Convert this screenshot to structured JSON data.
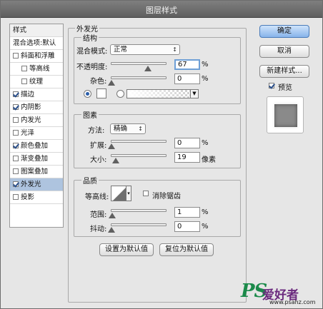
{
  "window": {
    "title": "图层样式"
  },
  "sidebar": {
    "header": "样式",
    "items": [
      {
        "label": "混合选项:默认",
        "checkbox": false,
        "checked": false,
        "indent": false,
        "selected": false
      },
      {
        "label": "斜面和浮雕",
        "checkbox": true,
        "checked": false,
        "indent": false,
        "selected": false
      },
      {
        "label": "等高线",
        "checkbox": true,
        "checked": false,
        "indent": true,
        "selected": false
      },
      {
        "label": "纹理",
        "checkbox": true,
        "checked": false,
        "indent": true,
        "selected": false
      },
      {
        "label": "描边",
        "checkbox": true,
        "checked": true,
        "indent": false,
        "selected": false
      },
      {
        "label": "内阴影",
        "checkbox": true,
        "checked": true,
        "indent": false,
        "selected": false
      },
      {
        "label": "内发光",
        "checkbox": true,
        "checked": false,
        "indent": false,
        "selected": false
      },
      {
        "label": "光泽",
        "checkbox": true,
        "checked": false,
        "indent": false,
        "selected": false
      },
      {
        "label": "颜色叠加",
        "checkbox": true,
        "checked": true,
        "indent": false,
        "selected": false
      },
      {
        "label": "渐变叠加",
        "checkbox": true,
        "checked": false,
        "indent": false,
        "selected": false
      },
      {
        "label": "图案叠加",
        "checkbox": true,
        "checked": false,
        "indent": false,
        "selected": false
      },
      {
        "label": "外发光",
        "checkbox": true,
        "checked": true,
        "indent": false,
        "selected": true
      },
      {
        "label": "投影",
        "checkbox": true,
        "checked": false,
        "indent": false,
        "selected": false
      }
    ]
  },
  "outer_glow": {
    "title": "外发光",
    "structure": {
      "title": "结构",
      "blend_mode_label": "混合模式:",
      "blend_mode_value": "正常",
      "opacity_label": "不透明度:",
      "opacity_value": "67",
      "opacity_fraction": 0.67,
      "noise_label": "杂色:",
      "noise_value": "0",
      "noise_fraction": 0.0,
      "unit": "%"
    },
    "elements": {
      "title": "图素",
      "method_label": "方法:",
      "method_value": "精确",
      "spread_label": "扩展:",
      "spread_value": "0",
      "spread_fraction": 0.0,
      "size_label": "大小:",
      "size_value": "19",
      "size_fraction": 0.076,
      "percent_unit": "%",
      "px_unit": "像素"
    },
    "quality": {
      "title": "品质",
      "contour_label": "等高线:",
      "antialias_label": "消除锯齿",
      "range_label": "范围:",
      "range_value": "1",
      "range_fraction": 0.01,
      "jitter_label": "抖动:",
      "jitter_value": "0",
      "jitter_fraction": 0.0,
      "unit": "%"
    },
    "set_default_label": "设置为默认值",
    "reset_default_label": "复位为默认值"
  },
  "buttons": {
    "ok": "确定",
    "cancel": "取消",
    "new_style": "新建样式...",
    "preview_label": "预览"
  },
  "watermark": {
    "brand": "PS",
    "cn": "爱好者",
    "url": "www.psahz.com"
  },
  "colors": {
    "accent": "#2b5ea9",
    "selected_row": "#aec4df",
    "watermark_green": "#1b8a4a",
    "watermark_purple": "#6b2a7e"
  }
}
